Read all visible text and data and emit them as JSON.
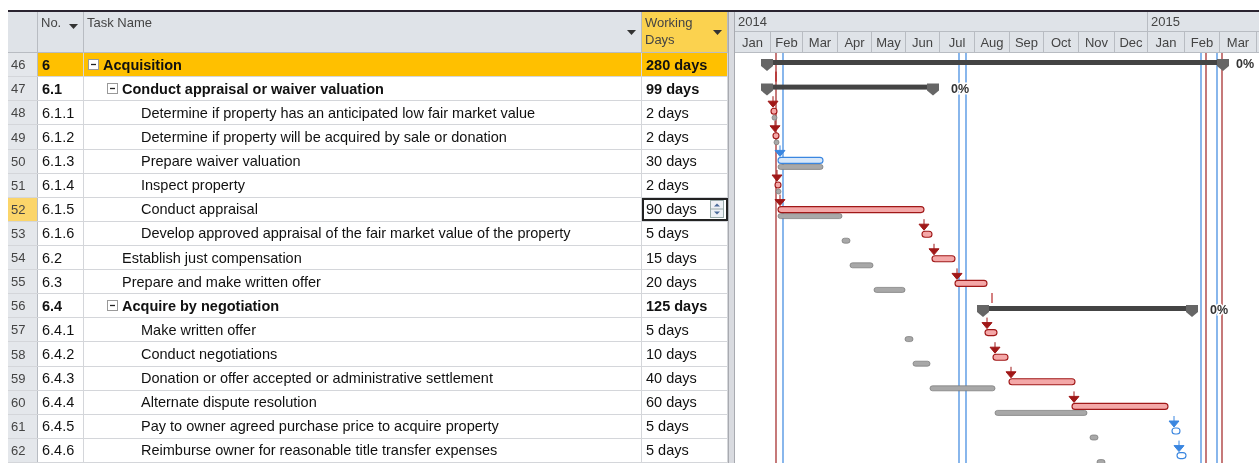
{
  "columns": [
    {
      "label": "No.",
      "selected": false
    },
    {
      "label": "Task Name",
      "selected": false
    },
    {
      "label": "Working Days",
      "selected": true
    }
  ],
  "timescale": {
    "years": [
      "2014",
      "2015"
    ],
    "months": [
      "Jan",
      "Feb",
      "Mar",
      "Apr",
      "May",
      "Jun",
      "Jul",
      "Aug",
      "Sep",
      "Oct",
      "Nov",
      "Dec",
      "Jan",
      "Feb",
      "Mar"
    ]
  },
  "tasks": [
    {
      "row": "46",
      "wbs": "6",
      "name": "Acquisition",
      "days": "280 days",
      "kind": "summary",
      "expanded": true,
      "highlighted": true,
      "selected": false,
      "progress_label": "0%",
      "children": [
        {
          "row": "47",
          "wbs": "6.1",
          "name": "Conduct appraisal or waiver valuation",
          "days": "99 days",
          "kind": "summary",
          "expanded": true,
          "highlighted": false,
          "selected": false,
          "progress_label": "0%",
          "children": [
            {
              "row": "48",
              "wbs": "6.1.1",
              "name": "Determine if property has an anticipated low fair market value",
              "days": "2 days",
              "kind": "task",
              "highlighted": false,
              "selected": false
            },
            {
              "row": "49",
              "wbs": "6.1.2",
              "name": "Determine if property will be acquired by sale or donation",
              "days": "2 days",
              "kind": "task",
              "highlighted": false,
              "selected": false
            },
            {
              "row": "50",
              "wbs": "6.1.3",
              "name": "Prepare waiver valuation",
              "days": "30 days",
              "kind": "task",
              "highlighted": false,
              "selected": false
            },
            {
              "row": "51",
              "wbs": "6.1.4",
              "name": "Inspect property",
              "days": "2 days",
              "kind": "task",
              "highlighted": false,
              "selected": false
            },
            {
              "row": "52",
              "wbs": "6.1.5",
              "name": "Conduct appraisal",
              "days": "90 days",
              "kind": "task",
              "highlighted": false,
              "selected": true,
              "editing": true
            },
            {
              "row": "53",
              "wbs": "6.1.6",
              "name": "Develop approved appraisal of the fair market value of the property",
              "days": "5 days",
              "kind": "task",
              "highlighted": false,
              "selected": false
            }
          ]
        },
        {
          "row": "54",
          "wbs": "6.2",
          "name": "Establish just compensation",
          "days": "15 days",
          "kind": "task",
          "highlighted": false,
          "selected": false
        },
        {
          "row": "55",
          "wbs": "6.3",
          "name": "Prepare and make written offer",
          "days": "20 days",
          "kind": "task",
          "highlighted": false,
          "selected": false
        },
        {
          "row": "56",
          "wbs": "6.4",
          "name": "Acquire by negotiation",
          "days": "125 days",
          "kind": "summary",
          "expanded": true,
          "highlighted": false,
          "selected": false,
          "progress_label": "0%",
          "children": [
            {
              "row": "57",
              "wbs": "6.4.1",
              "name": "Make written offer",
              "days": "5 days",
              "kind": "task",
              "highlighted": false,
              "selected": false
            },
            {
              "row": "58",
              "wbs": "6.4.2",
              "name": "Conduct negotiations",
              "days": "10 days",
              "kind": "task",
              "highlighted": false,
              "selected": false
            },
            {
              "row": "59",
              "wbs": "6.4.3",
              "name": "Donation or offer accepted or administrative settlement",
              "days": "40 days",
              "kind": "task",
              "highlighted": false,
              "selected": false
            },
            {
              "row": "60",
              "wbs": "6.4.4",
              "name": "Alternate dispute resolution",
              "days": "60 days",
              "kind": "task",
              "highlighted": false,
              "selected": false
            },
            {
              "row": "61",
              "wbs": "6.4.5",
              "name": "Pay to owner agreed purchase price to acquire property",
              "days": "5 days",
              "kind": "task",
              "highlighted": false,
              "selected": false
            },
            {
              "row": "62",
              "wbs": "6.4.6",
              "name": "Reimburse owner for reasonable title transfer expenses",
              "days": "5 days",
              "kind": "task",
              "highlighted": false,
              "selected": false
            }
          ]
        }
      ]
    }
  ]
}
